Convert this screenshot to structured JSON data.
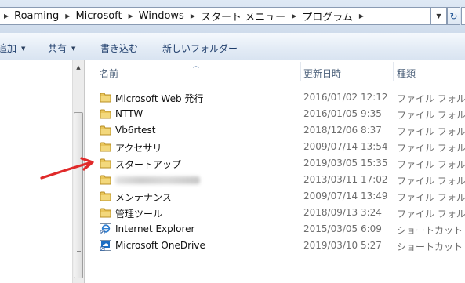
{
  "address_bar": {
    "breadcrumbs": [
      "Roaming",
      "Microsoft",
      "Windows",
      "スタート メニュー",
      "プログラム"
    ]
  },
  "command_bar": {
    "add_label": "追加",
    "share_label": "共有",
    "burn_label": "書き込む",
    "new_folder_label": "新しいフォルダー"
  },
  "columns": {
    "name": "名前",
    "date": "更新日時",
    "type": "種類"
  },
  "files": [
    {
      "name": "Microsoft Web 発行",
      "date": "2016/01/02 12:12",
      "type": "ファイル フォル",
      "icon": "folder-icon"
    },
    {
      "name": "NTTW",
      "date": "2016/01/05 9:35",
      "type": "ファイル フォル",
      "icon": "folder-icon"
    },
    {
      "name": "Vb6rtest",
      "date": "2018/12/06 8:37",
      "type": "ファイル フォル",
      "icon": "folder-icon"
    },
    {
      "name": "アクセサリ",
      "date": "2009/07/14 13:54",
      "type": "ファイル フォル",
      "icon": "folder-icon"
    },
    {
      "name": "スタートアップ",
      "date": "2019/03/05 15:35",
      "type": "ファイル フォル",
      "icon": "folder-icon"
    },
    {
      "name": "-",
      "date": "2013/03/11 17:02",
      "type": "ファイル フォル",
      "icon": "folder-icon",
      "obscured": true
    },
    {
      "name": "メンテナンス",
      "date": "2009/07/14 13:49",
      "type": "ファイル フォル",
      "icon": "folder-icon"
    },
    {
      "name": "管理ツール",
      "date": "2018/09/13 3:24",
      "type": "ファイル フォル",
      "icon": "folder-icon"
    },
    {
      "name": "Internet Explorer",
      "date": "2015/03/05 6:09",
      "type": "ショートカット",
      "icon": "internet-explorer-shortcut-icon"
    },
    {
      "name": "Microsoft OneDrive",
      "date": "2019/03/10 5:27",
      "type": "ショートカット",
      "icon": "onedrive-shortcut-icon"
    }
  ],
  "colors": {
    "folder": "#e9c55a",
    "annotation_arrow": "#e02a2a",
    "header_text": "#4c607a"
  }
}
